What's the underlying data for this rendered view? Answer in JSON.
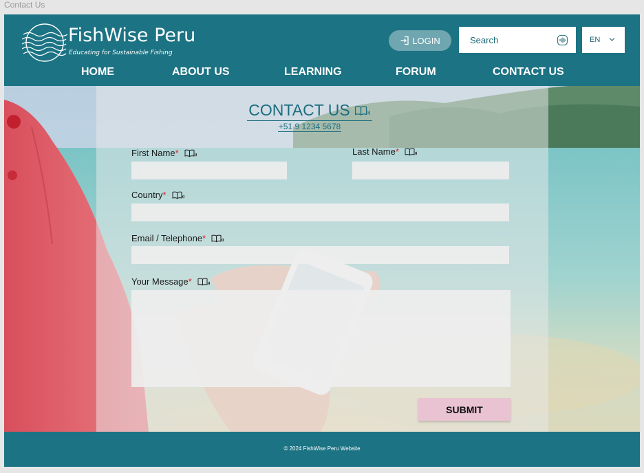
{
  "frame": {
    "label": "Contact Us"
  },
  "brand": {
    "name": "FishWise Peru",
    "tagline": "Educating for Sustainable Fishing"
  },
  "header": {
    "login_label": "LOGIN",
    "search_placeholder": "Search",
    "language": "EN"
  },
  "nav": {
    "items": [
      {
        "label": "HOME"
      },
      {
        "label": "ABOUT US"
      },
      {
        "label": "LEARNING"
      },
      {
        "label": "FORUM"
      },
      {
        "label": "CONTACT US"
      }
    ]
  },
  "contact": {
    "heading": "CONTACT US",
    "phone": "+51 9 1234 5678",
    "required_marker": "*",
    "fields": {
      "first_name": {
        "label": "First Name",
        "value": ""
      },
      "last_name": {
        "label": "Last Name",
        "value": ""
      },
      "country": {
        "label": "Country",
        "value": ""
      },
      "email_telephone": {
        "label": "Email / Telephone",
        "value": ""
      },
      "message": {
        "label": "Your Message",
        "value": ""
      }
    },
    "submit_label": "SUBMIT"
  },
  "footer": {
    "copyright": "© 2024 FishWise Peru Website"
  },
  "colors": {
    "primary_teal": "#1c7384",
    "heading_teal": "#1c6d80",
    "login_button": "#6fa6b0",
    "submit_button": "#e9c3d2",
    "required_red": "#d8202a"
  },
  "icons": {
    "login": "login-icon",
    "voice_search": "voice-search-icon",
    "language_dropdown": "chevron-down-icon",
    "read_aloud": "book-audio-icon",
    "logo_waves": "waves-logo-icon"
  }
}
